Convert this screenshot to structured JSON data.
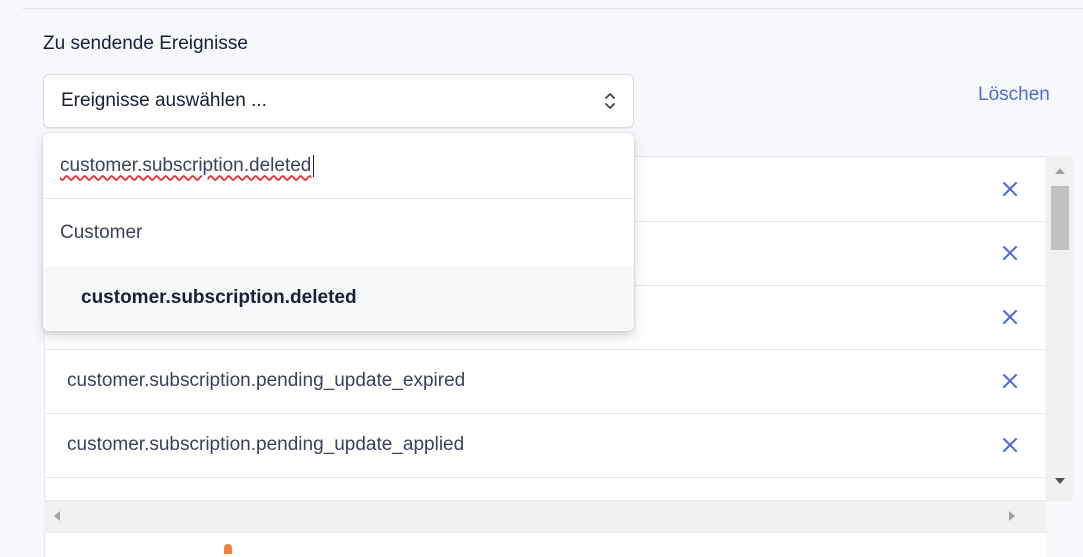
{
  "section": {
    "title": "Zu sendende Ereignisse"
  },
  "select": {
    "placeholder": "Ereignisse auswählen ..."
  },
  "clear_label": "Löschen",
  "dropdown": {
    "search_value": "customer.subscription.deleted",
    "group_label": "Customer",
    "option_label": "customer.subscription.deleted"
  },
  "events": [
    {
      "label": ""
    },
    {
      "label": ""
    },
    {
      "label": ""
    },
    {
      "label": "customer.subscription.pending_update_expired"
    },
    {
      "label": "customer.subscription.pending_update_applied"
    }
  ],
  "colors": {
    "accent": "#5469d4",
    "spellcheck": "#e0323c",
    "mark": "#f5803e"
  }
}
